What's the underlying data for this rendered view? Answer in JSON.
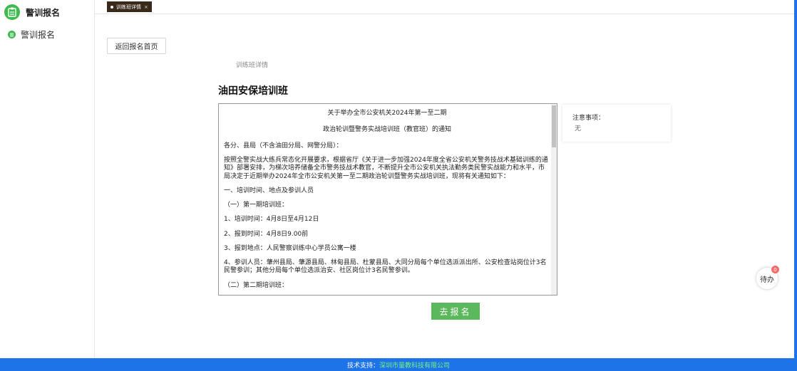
{
  "sidebar": {
    "brand_title": "警训报名",
    "items": [
      {
        "label": "警训报名"
      }
    ]
  },
  "tabs": [
    {
      "label": "训练班详情",
      "close": "×"
    }
  ],
  "main": {
    "back_button": "返回报名首页",
    "breadcrumb": "训练班详情",
    "title": "油田安保培训班",
    "document": {
      "title_line1": "关于举办全市公安机关2024年第一至二期",
      "title_line2": "政治轮训暨警务实战培训班（教官班）的通知",
      "paragraphs": [
        "各分、县局（不含油田分局、网警分局）：",
        "按照全警实战大练兵常态化开展要求，根据省厅《关于进一步加强2024年度全省公安机关警务技战术基础训练的通知》部署安排，为梯次培养储备全市警务技战术教官，不断提升全市公安机关执法勤务类民警实战能力和水平，市局决定于近期举办2024年全市公安机关第一至二期政治轮训暨警务实战培训班，现将有关通知如下：",
        "一、培训时间、地点及参训人员",
        "（一）第一期培训班：",
        "1、培训时间：4月8日至4月12日",
        "2、报到时间：4月8日9.00前",
        "3、报到地点：人民警察训练中心学员公寓一楼",
        "4、参训人员：肇州县局、肇源县局、林甸县局、杜蒙县局、大同分局每个单位选派派出所、公安检查站岗位计3名民警参训；其他分局每个单位选派治安、社区岗位计3名民警参训。",
        "（二）第二期培训班："
      ]
    },
    "notice": {
      "label": "注意事项：",
      "value": "无"
    },
    "signup_button": "去报名"
  },
  "float": {
    "pending_label": "待办",
    "pending_count": "0"
  },
  "footer": {
    "prefix": "技术支持：",
    "company": "深圳市量教科技有限公司"
  },
  "colors": {
    "accent_green": "#5cb85c",
    "footer_blue": "#1e73e8",
    "tab_bg": "#3a2a1a"
  }
}
